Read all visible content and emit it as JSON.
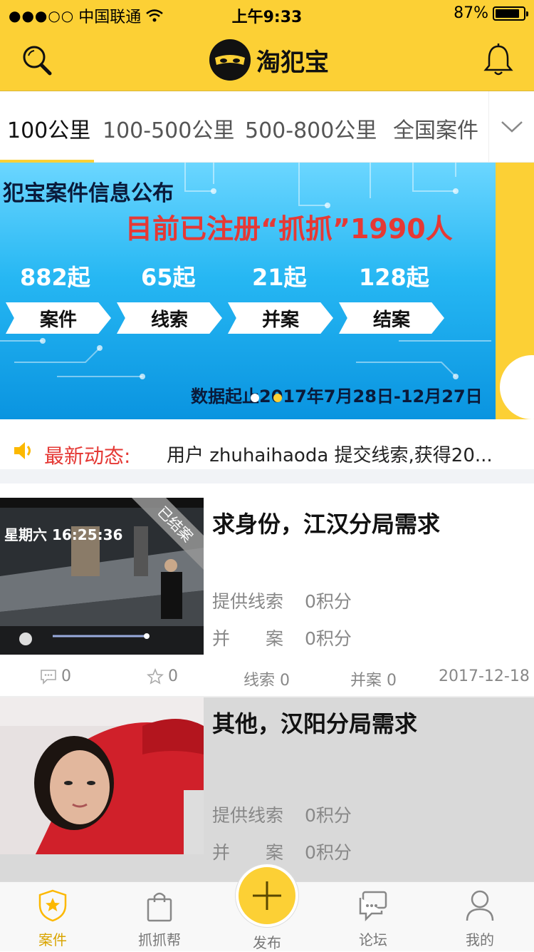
{
  "status_bar": {
    "signal": "●●●○○",
    "carrier": "中国联通",
    "time": "上午9:33",
    "battery": "87%",
    "battery_level": 0.87
  },
  "header": {
    "brand_name": "淘犯宝",
    "icons": [
      "search-icon",
      "bell-icon"
    ]
  },
  "tabs": {
    "items": [
      "100公里",
      "100-500公里",
      "500-800公里",
      "全国案件"
    ],
    "active_index": 0
  },
  "banner": {
    "line1": "犯宝案件信息公布",
    "line2": "目前已注册“抓抓”1990人",
    "stats": [
      {
        "value": "882起",
        "label": "案件"
      },
      {
        "value": "65起",
        "label": "线索"
      },
      {
        "value": "21起",
        "label": "并案"
      },
      {
        "value": "128起",
        "label": "结案"
      }
    ],
    "period": "数据起止2017年7月28日-12月27日"
  },
  "news": {
    "label": "最新动态:",
    "text": "用户 zhuhaihaoda 提交线索,获得20..."
  },
  "cases": [
    {
      "title": "求身份，江汉分局需求",
      "ribbon": "已结案",
      "overlay_time": "星期六 16:25:36",
      "clue_label": "提供线索",
      "clue_value": "0积分",
      "merge_label": "并　　案",
      "merge_value": "0积分",
      "comments": "0",
      "favorites": "0",
      "clues": "线索 0",
      "merges": "并案 0",
      "date": "2017-12-18"
    },
    {
      "title": "其他，汉阳分局需求",
      "clue_label": "提供线索",
      "clue_value": "0积分",
      "merge_label": "并　　案",
      "merge_value": "0积分"
    }
  ],
  "tabbar": {
    "items": [
      "案件",
      "抓抓帮",
      "发布",
      "论坛",
      "我的"
    ],
    "active_index": 0
  },
  "colors": {
    "brand_yellow": "#fcd035",
    "alert_red": "#e53935",
    "banner_blue": "#26b7f3"
  }
}
